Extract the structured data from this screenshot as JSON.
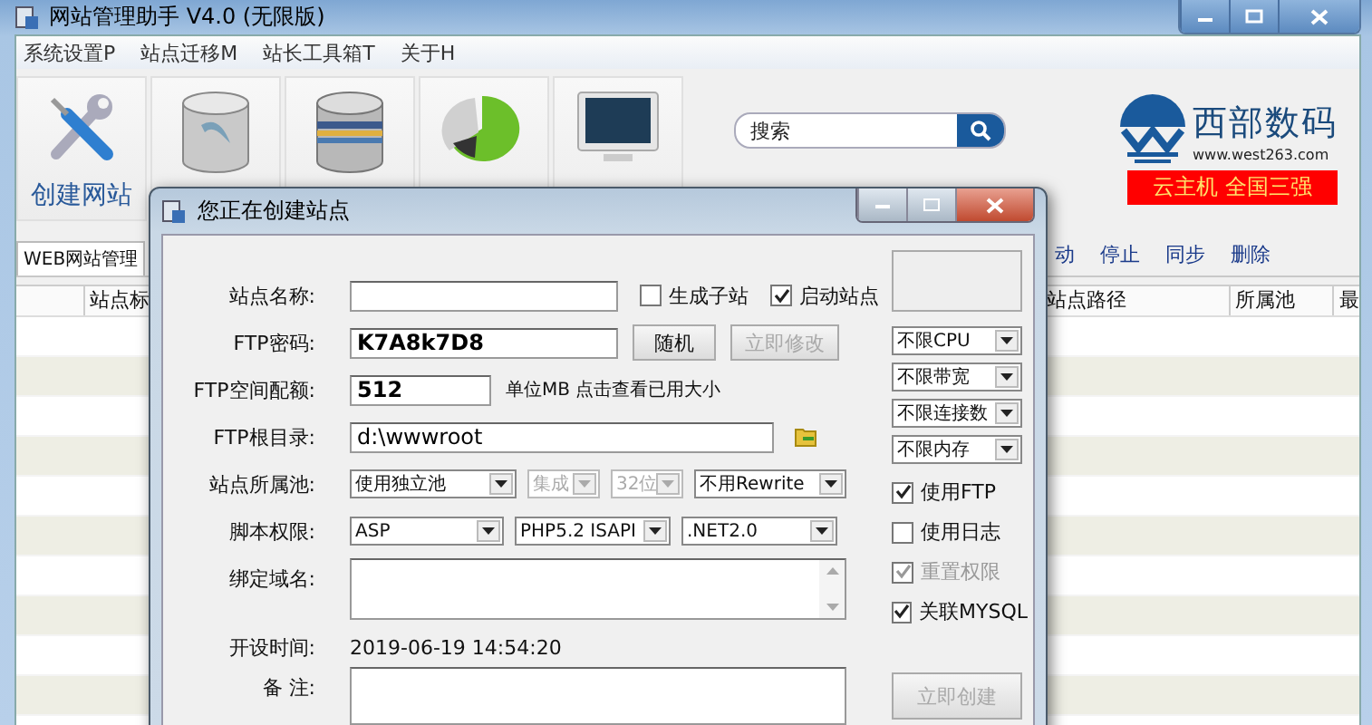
{
  "window": {
    "title": "网站管理助手 V4.0 (无限版)"
  },
  "menu": [
    "系统设置P",
    "站点迁移M",
    "站长工具箱T",
    "关于H"
  ],
  "toolbar": [
    {
      "kind": "tools",
      "label": "创建网站"
    },
    {
      "kind": "database"
    },
    {
      "kind": "stack"
    },
    {
      "kind": "pie"
    },
    {
      "kind": "monitor"
    }
  ],
  "search": {
    "placeholder": "搜索"
  },
  "brand": {
    "name": "西部数码",
    "url": "www.west263.com",
    "banner": "云主机 全国三强"
  },
  "tab": {
    "label": "WEB网站管理"
  },
  "actions": [
    "动",
    "停止",
    "同步",
    "删除"
  ],
  "table": {
    "columns": [
      "站点标",
      "站点路径",
      "所属池",
      "最"
    ]
  },
  "dialog": {
    "title": "您正在创建站点",
    "fields": [
      {
        "kind": "name",
        "label": "站点名称:"
      },
      {
        "kind": "password",
        "label": "FTP密码:",
        "value": "K7A8k7D8"
      },
      {
        "kind": "quota",
        "label": "FTP空间配额:",
        "value": "512",
        "note": "单位MB 点击查看已用大小"
      },
      {
        "kind": "root",
        "label": "FTP根目录:",
        "value": "d:\\wwwroot"
      },
      {
        "kind": "selects",
        "label": "站点所属池:",
        "options": [
          {
            "value": "使用独立池",
            "disabled": false
          },
          {
            "value": "集成",
            "disabled": true
          },
          {
            "value": "32位",
            "disabled": true
          },
          {
            "value": "不用Rewrite",
            "disabled": false
          }
        ]
      },
      {
        "kind": "selects",
        "label": "脚本权限:",
        "options": [
          {
            "value": "ASP",
            "disabled": false
          },
          {
            "value": "PHP5.2 ISAPI",
            "disabled": false
          },
          {
            "value": ".NET2.0",
            "disabled": false
          }
        ]
      },
      {
        "kind": "domains",
        "label": "绑定域名:"
      },
      {
        "kind": "static",
        "label": "开设时间:",
        "value": "2019-06-19 14:54:20"
      },
      {
        "kind": "notes",
        "label": "备 注:"
      }
    ],
    "site_options": [
      {
        "label": "生成子站",
        "checked": false
      },
      {
        "label": "启动站点",
        "checked": true
      }
    ],
    "password_buttons": [
      {
        "label": "随机",
        "disabled": false
      },
      {
        "label": "立即修改",
        "disabled": true
      }
    ],
    "limits": [
      "不限CPU",
      "不限带宽",
      "不限连接数",
      "不限内存"
    ],
    "switches": [
      {
        "label": "使用FTP",
        "checked": true,
        "disabled": false
      },
      {
        "label": "使用日志",
        "checked": false,
        "disabled": false
      },
      {
        "label": "重置权限",
        "checked": true,
        "disabled": true
      },
      {
        "label": "关联MYSQL",
        "checked": true,
        "disabled": false
      }
    ],
    "create_button": {
      "label": "立即创建",
      "disabled": true
    }
  }
}
